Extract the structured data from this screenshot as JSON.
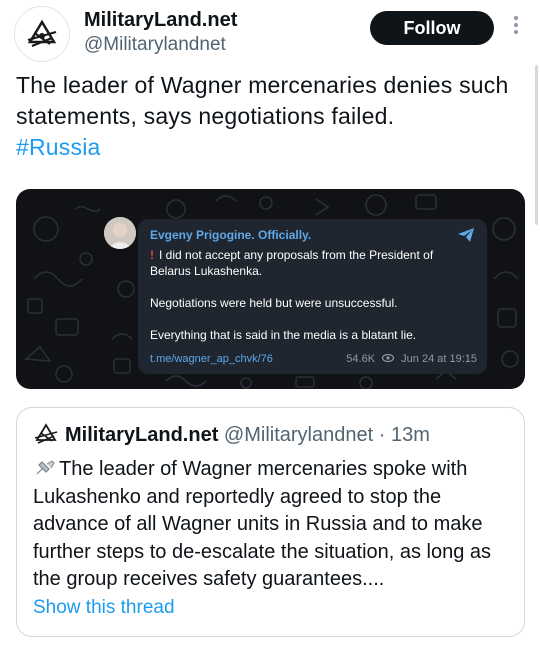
{
  "header": {
    "display_name": "MilitaryLand.net",
    "handle": "@Militarylandnet",
    "follow_label": "Follow",
    "avatar_icon": "militaryland-logo-icon",
    "more_icon": "more-options-icon"
  },
  "tweet": {
    "text": "The leader of Wagner mercenaries denies such statements, says negotiations failed.",
    "hashtag": "#Russia"
  },
  "media": {
    "author": "Evgeny Prigogine. Officially.",
    "excl": "!",
    "line1": "I did not accept any proposals from the President of Belarus Lukashenka.",
    "line2": "Negotiations were held but were unsuccessful.",
    "line3": "Everything that is said in the media is a blatant lie.",
    "link": "t.me/wagner_ap_chvk/76",
    "views": "54.6K",
    "date": "Jun 24 at 19:15",
    "icon_send": "telegram-send-icon",
    "icon_views": "eye-icon"
  },
  "quote": {
    "display_name": "MilitaryLand.net",
    "handle": "@Militarylandnet",
    "separator": " · ",
    "time": "13m",
    "text": "The leader of Wagner mercenaries spoke with Lukashenko and reportedly agreed to stop the advance of all Wagner units in Russia and to make further steps to de-escalate the situation, as long as the group receives safety guarantees....",
    "show_thread": "Show this thread"
  },
  "colors": {
    "link_blue": "#1d9bf0",
    "telegram_blue": "#5fa8ea",
    "follow_bg": "#0f1419",
    "media_bg": "#101216",
    "bubble_bg": "#1f262f"
  }
}
